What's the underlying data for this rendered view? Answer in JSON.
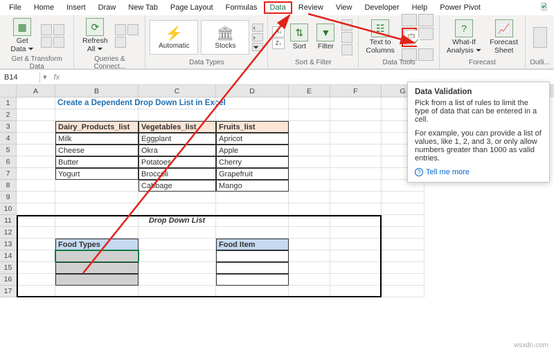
{
  "ribbon": {
    "tabs": [
      "File",
      "Home",
      "Insert",
      "Draw",
      "New Tab",
      "Page Layout",
      "Formulas",
      "Data",
      "Review",
      "View",
      "Developer",
      "Help",
      "Power Pivot"
    ],
    "active_tab": "Data",
    "groups": {
      "get_transform": {
        "get_data": "Get\nData ⏷",
        "label": "Get & Transform Data"
      },
      "queries": {
        "refresh_all": "Refresh\nAll ⏷",
        "label": "Queries & Connect..."
      },
      "data_types": {
        "automatic": "Automatic",
        "stocks": "Stocks",
        "label": "Data Types"
      },
      "sort_filter": {
        "sort": "Sort",
        "filter": "Filter",
        "label": "Sort & Filter"
      },
      "data_tools": {
        "text_to_columns": "Text to\nColumns",
        "label": "Data Tools"
      },
      "forecast": {
        "what_if": "What-If\nAnalysis ⏷",
        "forecast_sheet": "Forecast\nSheet",
        "label": "Forecast"
      },
      "outline": {
        "label": "Outli..."
      }
    }
  },
  "namebox": "B14",
  "columns": [
    "A",
    "B",
    "C",
    "D",
    "E",
    "F",
    "G"
  ],
  "rows_count": 17,
  "cells": {
    "title": "Create a Dependent Drop Down List in Excel",
    "headers": [
      "Dairy_Products_list",
      "Vegetables_list",
      "Fruits_list"
    ],
    "data": [
      [
        "Milk",
        "Eggplant",
        "Apricot"
      ],
      [
        "Cheese",
        "Okra",
        "Apple"
      ],
      [
        "Butter",
        "Potatoes",
        "Cherry"
      ],
      [
        "Yogurt",
        "Broccoli",
        "Grapefruit"
      ],
      [
        "",
        "Cabbage",
        "Mango"
      ]
    ],
    "ddl_title": "Drop Down List",
    "food_types": "Food Types",
    "food_item": "Food Item"
  },
  "tooltip": {
    "title": "Data Validation",
    "body1": "Pick from a list of rules to limit the type of data that can be entered in a cell.",
    "body2": "For example, you can provide a list of values, like 1, 2, and 3, or only allow numbers greater than 1000 as valid entries.",
    "more": "Tell me more"
  },
  "watermark": "wsxdn.com"
}
